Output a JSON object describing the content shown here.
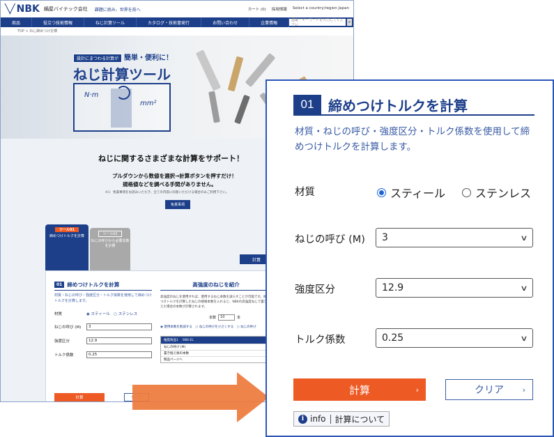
{
  "site": {
    "logo": "NBK",
    "company": "鍋屋バイテック会社",
    "tagline": "課題に挑み、世界を前へ",
    "top_links": [
      "カート (0)",
      "採用情報",
      "Select a country/region Japan"
    ],
    "nav": [
      "商品",
      "役立つ技術情報",
      "ねじ計算ツール",
      "カタログ・技術書発行",
      "お問い合わせ",
      "企業情報"
    ],
    "search_placeholder": "品番・キーワードを入力してください",
    "breadcrumb": "TOP > ねじ締めつけ計算",
    "hero": {
      "badge": "設計にまつわる計算が",
      "sub": "簡単・便利に！",
      "title": "ねじ計算ツール",
      "nm": "N·m",
      "mm2": "mm²"
    },
    "intro": {
      "heading": "ねじに関するさまざまな計算をサポート！",
      "line1": "プルダウンから数値を選択→計算ボタンを押すだけ！",
      "line2": "規格値などを調べる手間がありません。",
      "note": "※1：免責事項をお読みいただき、全ての内容に同意いただける場合のみご利用下さい。",
      "free_button": "免責事項"
    },
    "tool_tab1": {
      "tag": "ツール01",
      "text": "締めつけトルクを計算"
    },
    "tool_tab2": {
      "tag": "ツール02",
      "text": "ねじの呼びから必要本数を計算"
    },
    "right_button": "計算",
    "mini": {
      "num": "01",
      "title": "締めつけトルクを計算",
      "desc": "材質・ねじの呼び・強度区分・トルク係数を使用して締めつけトルクを計算します。",
      "rows": [
        {
          "label": "材質",
          "value": "◉ スティール　○ ステンレス"
        },
        {
          "label": "ねじの呼び (M)",
          "value": "3"
        },
        {
          "label": "強度区分",
          "value": "12.9"
        },
        {
          "label": "トルク係数",
          "value": "0.25"
        }
      ],
      "calc": "計算",
      "clear": "クリア",
      "right_title": "高強度のねじを紹介",
      "right_text": "高強度のねじを使用すれば、使用するねじ本数を減らすことが可能です。締めつけトルクを計算したねじの規格本数を入れると、NBKの高強度ねじで置き換えた場合の本数が計算されます。",
      "count_label": "本数",
      "count_value": "10",
      "count_unit": "本",
      "radios": "◉ 使用本数を削減する　○ ねじの呼びを小さくする　○ ねじの呼び",
      "table_header": [
        "推奨商品1",
        "SNS-EL"
      ],
      "table_rows": [
        "ねじの呼び (M)",
        "置き換え後の本数",
        "製品ページへ"
      ]
    }
  },
  "zoom": {
    "num": "01",
    "title": "締めつけトルクを計算",
    "description": "材質・ねじの呼び・強度区分・トルク係数を使用して締めつけトルクを計算します。",
    "material_label": "材質",
    "material_options": [
      "スティール",
      "ステンレス"
    ],
    "material_selected": "スティール",
    "size_label": "ねじの呼び (M)",
    "size_value": "3",
    "grade_label": "強度区分",
    "grade_value": "12.9",
    "coef_label": "トルク係数",
    "coef_value": "0.25",
    "calc_button": "計算",
    "clear_button": "クリア",
    "info_label": "info",
    "info_text": "計算について"
  },
  "colors": {
    "brand_blue": "#1d3f8a",
    "accent_orange": "#ee5a24",
    "frame_blue": "#2a56b8"
  }
}
